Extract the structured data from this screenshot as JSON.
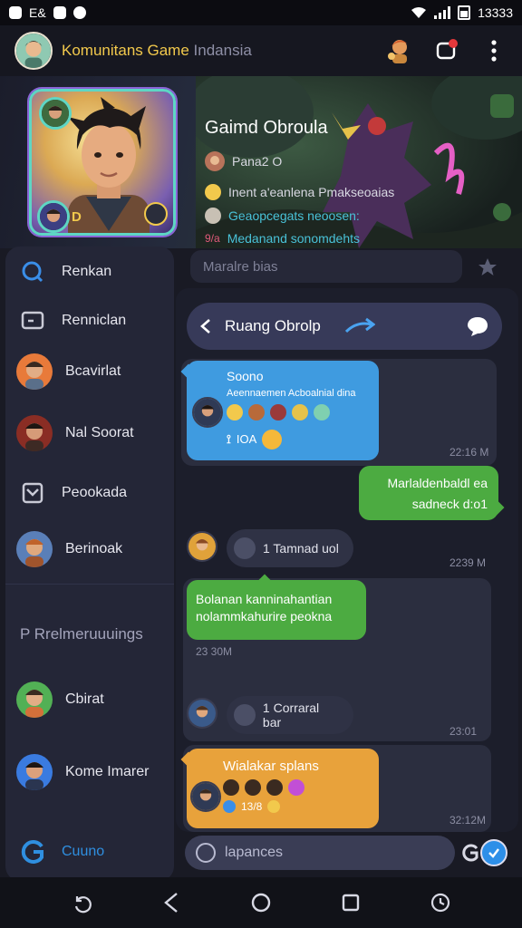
{
  "status_bar": {
    "left_text": "E&",
    "time": "13333"
  },
  "header": {
    "title_main": "Komunitans Game",
    "title_sub": "Indansia"
  },
  "hero": {
    "group_title": "Gaimd Obroula",
    "member_label": "Pana2 O",
    "line1": "Inent a'eanlena Pmakseoaias",
    "line2": "Geaopcegats neoosen:",
    "line3_prefix": "9/a",
    "line3": "Medanand sonomdehts",
    "badge_letter": "D"
  },
  "sidebar": {
    "items": [
      {
        "label": "Renkan",
        "icon": "search-icon"
      },
      {
        "label": "Renniclan",
        "icon": "message-icon"
      },
      {
        "label": "Bcavirlat",
        "icon": "avatar"
      },
      {
        "label": "Nal Soorat",
        "icon": "avatar"
      },
      {
        "label": "Peookada",
        "icon": "chart-icon"
      },
      {
        "label": "Berinoak",
        "icon": "avatar"
      }
    ],
    "section_title": "P  Rrelmeruuuings",
    "bottom_items": [
      {
        "label": "Cbirat",
        "icon": "avatar"
      },
      {
        "label": "Kome Imarer",
        "icon": "avatar"
      }
    ],
    "footer_label": "Cuuno"
  },
  "chat": {
    "search_placeholder": "Maralre bias",
    "room_title": "Ruang Obrolp",
    "messages": [
      {
        "type": "incoming",
        "color": "blue",
        "title": "Soono",
        "text": "Aeennaemen Acboalnial dina",
        "meta": "IOA",
        "time": "22:16 M"
      },
      {
        "type": "outgoing",
        "color": "green",
        "text1": "Marlaldenbaldl ea",
        "text2": "sadneck d:o1"
      },
      {
        "type": "pill",
        "text": "1 Tamnad uol",
        "time": "2239 M"
      },
      {
        "type": "incoming",
        "color": "green",
        "text1": "Bolanan kanninahantian",
        "text2": "nolammkahurire peokna",
        "time": "23 30M"
      },
      {
        "type": "pill",
        "text": "1 Corraral bar",
        "time": "23:01"
      },
      {
        "type": "incoming",
        "color": "orange",
        "text": "Wialakar splans",
        "meta": "13/8",
        "time": "32:12M"
      }
    ],
    "input_placeholder": "lapances"
  },
  "colors": {
    "accent_yellow": "#f2c94c",
    "blue_bubble": "#3f9be0",
    "green_bubble": "#4cab41",
    "orange_bubble": "#e8a23b",
    "room_bar": "#373a59"
  }
}
